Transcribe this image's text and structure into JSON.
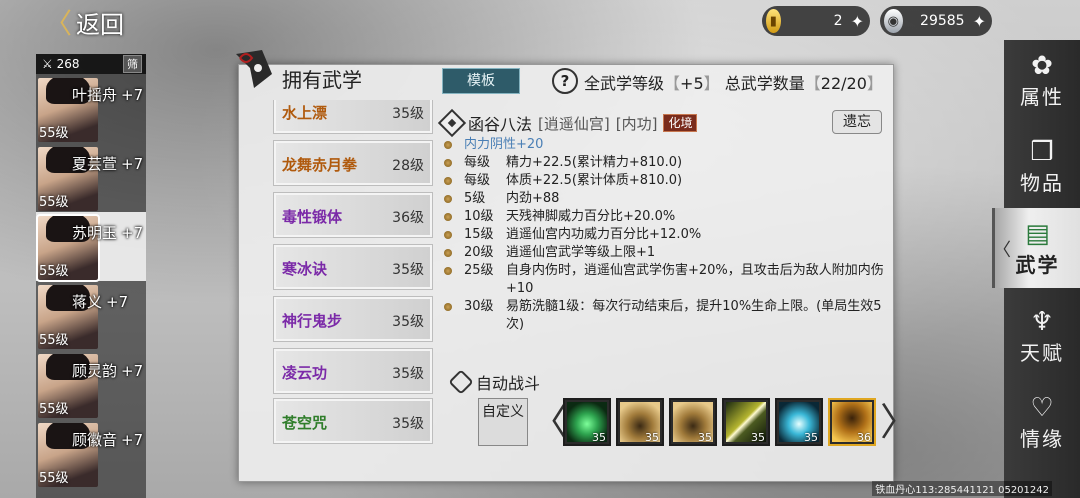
{
  "topbar": {
    "back_label": "返回",
    "gold": "2",
    "silver": "29585"
  },
  "sidebar": {
    "sort_value": "268",
    "filter_label": "筛",
    "heroes": [
      {
        "name": "叶摇舟",
        "bonus": "+7",
        "level": "55级"
      },
      {
        "name": "夏芸萱",
        "bonus": "+7",
        "level": "55级"
      },
      {
        "name": "苏明玉",
        "bonus": "+7",
        "level": "55级"
      },
      {
        "name": "蒋义",
        "bonus": "+7",
        "level": "55级"
      },
      {
        "name": "顾灵韵",
        "bonus": "+7",
        "level": "55级"
      },
      {
        "name": "顾徽音",
        "bonus": "+7",
        "level": "55级"
      }
    ]
  },
  "nav": {
    "items": [
      {
        "label": "属性",
        "icon": "attribute-icon"
      },
      {
        "label": "物品",
        "icon": "item-icon"
      },
      {
        "label": "武学",
        "icon": "martial-book-icon"
      },
      {
        "label": "天赋",
        "icon": "talent-icon"
      },
      {
        "label": "情缘",
        "icon": "heart-icon"
      }
    ]
  },
  "panel": {
    "title": "拥有武学",
    "template_label": "模板",
    "total_level_label": "全武学等级",
    "total_level_value": "+5",
    "total_count_label": "总武学数量",
    "total_count_value": "22/20"
  },
  "skills": [
    {
      "name": "水上漂",
      "level": "35级",
      "color": "orange"
    },
    {
      "name": "龙舞赤月拳",
      "level": "28级",
      "color": "orange"
    },
    {
      "name": "毒性锻体",
      "level": "36级",
      "color": "purple"
    },
    {
      "name": "寒冰诀",
      "level": "35级",
      "color": "purple"
    },
    {
      "name": "神行鬼步",
      "level": "35级",
      "color": "purple"
    },
    {
      "name": "凌云功",
      "level": "35级",
      "color": "purple"
    },
    {
      "name": "苍空咒",
      "level": "35级",
      "color": "green"
    }
  ],
  "detail": {
    "name": "函谷八法",
    "school": "[逍遥仙宫]",
    "type": "[内功]",
    "tag": "化境",
    "forget_label": "遗忘",
    "effects": [
      {
        "level": "",
        "text": "内力阴性+20",
        "style": "blue"
      },
      {
        "level": "每级",
        "text": "精力+22.5(累计精力+810.0)"
      },
      {
        "level": "每级",
        "text": "体质+22.5(累计体质+810.0)"
      },
      {
        "level": "5级",
        "text": "内劲+88"
      },
      {
        "level": "10级",
        "text": "天残神脚威力百分比+20.0%"
      },
      {
        "level": "15级",
        "text": "逍遥仙宫内功威力百分比+12.0%"
      },
      {
        "level": "20级",
        "text": "逍遥仙宫武学等级上限+1"
      },
      {
        "level": "25级",
        "text": "自身内伤时，逍遥仙宫武学伤害+20%，且攻击后为敌人附加内伤+10"
      },
      {
        "level": "30级",
        "text": "易筋洗髓1级：每次行动结束后，提升10%生命上限。(单局生效5次)"
      }
    ],
    "auto_battle_label": "自动战斗",
    "custom_label": "自定义",
    "slots": [
      {
        "count": "35",
        "icon": "green-meditation-icon",
        "accent": "#2ea44f"
      },
      {
        "count": "35",
        "icon": "golden-meditation-icon",
        "accent": "#a07a3a"
      },
      {
        "count": "35",
        "icon": "golden-meditation-icon",
        "accent": "#a07a3a"
      },
      {
        "count": "35",
        "icon": "sword-slash-icon",
        "accent": "#b5b530"
      },
      {
        "count": "35",
        "icon": "ice-orb-icon",
        "accent": "#3ab8d8"
      },
      {
        "count": "36",
        "icon": "leaping-fighter-icon",
        "accent": "#e0a721"
      }
    ]
  },
  "watermark": "铁血丹心113:285441121 05201242"
}
